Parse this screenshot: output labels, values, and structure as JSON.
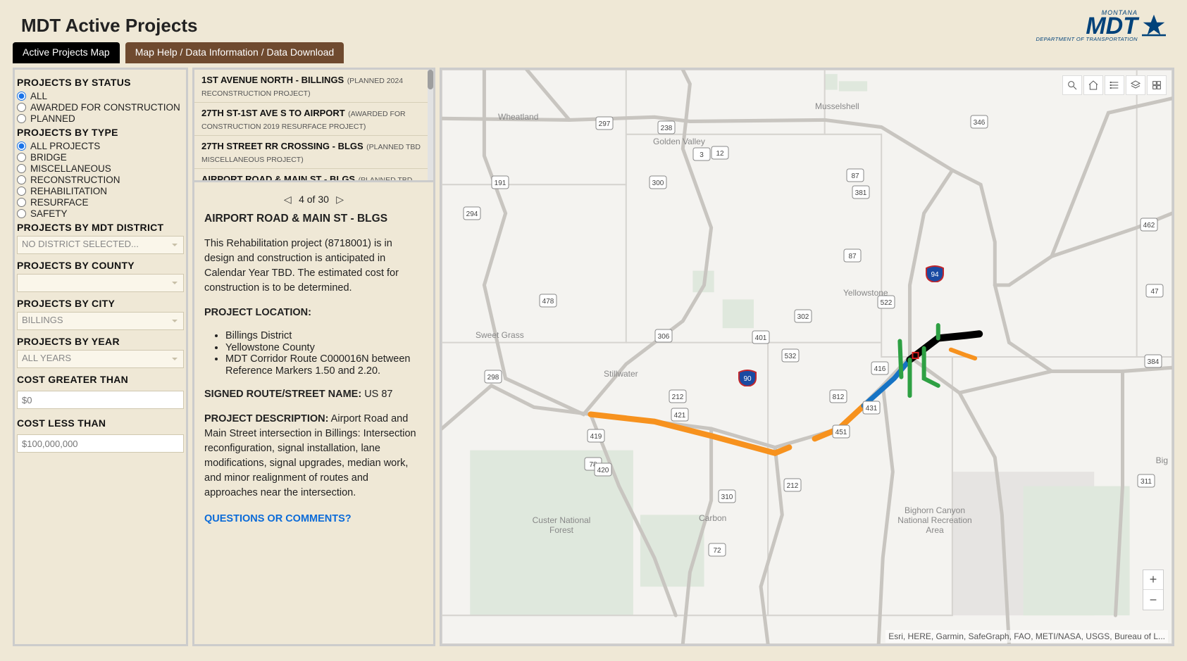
{
  "header": {
    "title": "MDT Active Projects"
  },
  "logo": {
    "montana": "MONTANA",
    "mdt": "MDT",
    "sub": "DEPARTMENT OF TRANSPORTATION"
  },
  "tabs": {
    "active": "Active Projects Map",
    "help": "Map Help / Data Information / Data Download"
  },
  "filters": {
    "status": {
      "heading": "PROJECTS BY STATUS",
      "options": {
        "all": "ALL",
        "awarded": "AWARDED FOR CONSTRUCTION",
        "planned": "PLANNED"
      }
    },
    "type": {
      "heading": "PROJECTS BY TYPE",
      "options": {
        "all": "ALL PROJECTS",
        "bridge": "BRIDGE",
        "misc": "MISCELLANEOUS",
        "recon": "RECONSTRUCTION",
        "rehab": "REHABILITATION",
        "resurf": "RESURFACE",
        "safety": "SAFETY"
      }
    },
    "district": {
      "heading": "PROJECTS BY MDT DISTRICT",
      "placeholder": "NO DISTRICT SELECTED..."
    },
    "county": {
      "heading": "PROJECTS BY COUNTY",
      "placeholder": ""
    },
    "city": {
      "heading": "PROJECTS BY CITY",
      "value": "BILLINGS"
    },
    "year": {
      "heading": "PROJECTS BY YEAR",
      "value": "ALL YEARS"
    },
    "gt": {
      "heading": "COST GREATER THAN",
      "placeholder": "$0"
    },
    "lt": {
      "heading": "COST LESS THAN",
      "placeholder": "$100,000,000"
    }
  },
  "projects": [
    {
      "title": "1ST AVENUE NORTH - BILLINGS",
      "meta": "(PLANNED 2024 RECONSTRUCTION PROJECT)"
    },
    {
      "title": "27TH ST-1ST AVE S TO AIRPORT",
      "meta": "(AWARDED FOR CONSTRUCTION 2019 RESURFACE PROJECT)"
    },
    {
      "title": "27TH STREET RR CROSSING - BLGS",
      "meta": "(PLANNED TBD MISCELLANEOUS PROJECT)"
    },
    {
      "title": "AIRPORT ROAD & MAIN ST - BLGS",
      "meta": "(PLANNED TBD REHABILITATION PROJECT)"
    }
  ],
  "pager": {
    "pos": "4 of 30"
  },
  "detail": {
    "title": "AIRPORT ROAD & MAIN ST - BLGS",
    "intro": "This Rehabilitation project (8718001) is in design and construction is anticipated in Calendar Year TBD. The estimated cost for construction is to be determined.",
    "loc": {
      "heading": "PROJECT LOCATION:",
      "district": "Billings District",
      "county": "Yellowstone County",
      "corridor": "MDT Corridor Route C000016N between Reference Markers 1.50 and 2.20."
    },
    "route": {
      "label": "SIGNED ROUTE/STREET NAME:",
      "value": "US 87"
    },
    "desc": {
      "label": "PROJECT DESCRIPTION:",
      "text": "Airport Road and Main Street intersection in Billings: Intersection reconfiguration, signal installation, lane modifications, signal upgrades, median work, and minor realignment of routes and approaches near the intersection."
    },
    "questions": "QUESTIONS OR COMMENTS?"
  },
  "map": {
    "attrib": "Esri, HERE, Garmin, SafeGraph, FAO, METI/NASA, USGS, Bureau of L...",
    "counties": {
      "wheatland": "Wheatland",
      "goldenvalley": "Golden Valley",
      "musselshell": "Musselshell",
      "sweetgrass": "Sweet Grass",
      "stillwater": "Stillwater",
      "yellowstone": "Yellowstone",
      "carbon": "Carbon",
      "big": "Big"
    },
    "places": {
      "bighorn": "Bighorn Canyon National Recreation Area",
      "custer": "Custer National Forest"
    },
    "routes": {
      "r191": "191",
      "r3": "3",
      "r12": "12",
      "r87b": "87",
      "r87a": "87",
      "r297": "297",
      "r238": "238",
      "r302": "302",
      "r401": "401",
      "r532": "532",
      "r416": "416",
      "r522": "522",
      "r384": "384",
      "r47": "47",
      "r381": "381",
      "r478": "478",
      "r300": "300",
      "r90": "90",
      "r298": "298",
      "r306": "306",
      "r310": "310",
      "r72": "72",
      "r78": "78",
      "r212a": "212",
      "r212b": "212",
      "r419": "419",
      "r420": "420",
      "r421": "421",
      "r431": "431",
      "r451": "451",
      "r311": "311",
      "r812": "812",
      "r462": "462",
      "r346": "346",
      "r294": "294"
    },
    "interstates": {
      "i94": "94",
      "i90": "90"
    }
  }
}
